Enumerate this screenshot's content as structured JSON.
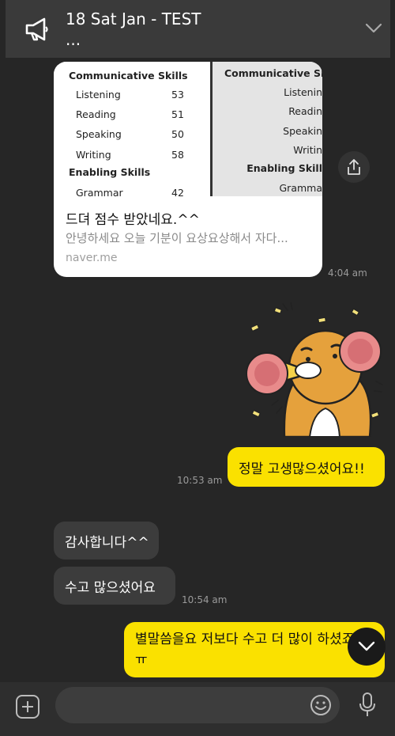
{
  "notice": {
    "title": "18 Sat Jan - TEST",
    "subtitle": "..."
  },
  "link_card": {
    "score_left": {
      "heading1": "Communicative Skills",
      "items": [
        {
          "label": "Listening",
          "value": "53"
        },
        {
          "label": "Reading",
          "value": "51"
        },
        {
          "label": "Speaking",
          "value": "50"
        },
        {
          "label": "Writing",
          "value": "58"
        }
      ],
      "heading2": "Enabling Skills",
      "items2": [
        {
          "label": "Grammar",
          "value": "42"
        }
      ]
    },
    "score_right": {
      "heading1": "Communicative Skil",
      "items": [
        "Listenin",
        "Readin",
        "Speakin",
        "Writin"
      ],
      "heading2": "Enabling Skill",
      "items2": [
        "Gramma"
      ]
    },
    "title": "드뎌 점수 받았네요.^^",
    "description": "안녕하세요 오늘 기분이 요상요상해서 자다...",
    "host": "naver.me",
    "time": "4:04 am"
  },
  "messages": [
    {
      "text": "정말 고생많으셨어요!!",
      "time": "10:53 am"
    },
    {
      "text": "감사합니다^^"
    },
    {
      "text": "수고 많으셨어요",
      "time": "10:54 am"
    },
    {
      "line1": "별말씀을요 저보다 수고 더 많이 하셨죠",
      "line2": "ㅠ"
    }
  ],
  "input": {
    "placeholder": ""
  },
  "colors": {
    "background": "#262626",
    "my_bubble": "#fae100",
    "their_bubble": "#3c3c3c"
  },
  "icons": [
    "megaphone-icon",
    "chevron-down-icon",
    "share-icon",
    "plus-icon",
    "emoji-icon",
    "mic-icon"
  ]
}
